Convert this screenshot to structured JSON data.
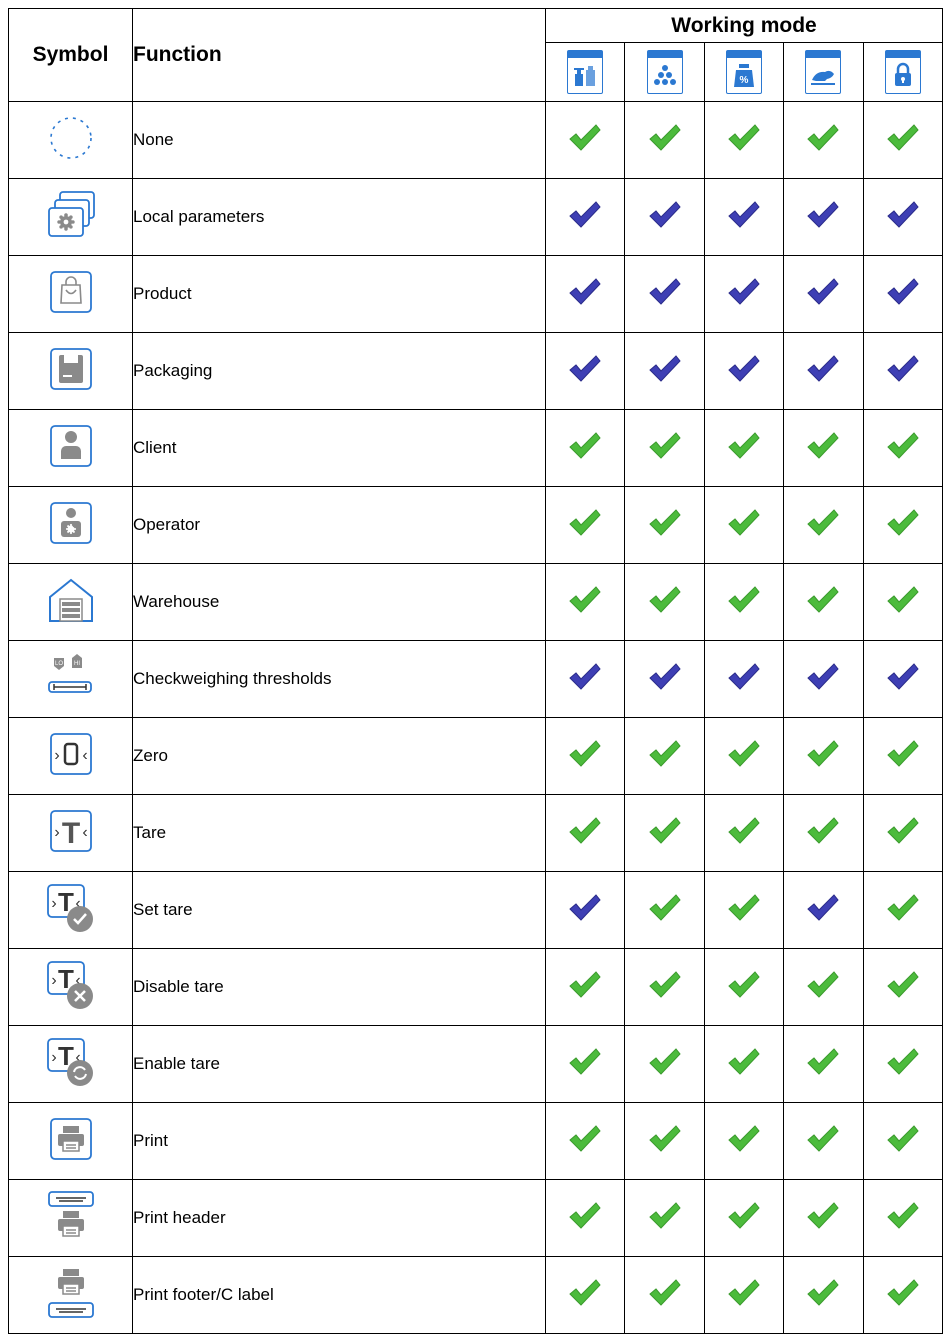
{
  "header": {
    "symbol": "Symbol",
    "function": "Function",
    "working_mode": "Working mode"
  },
  "modes": [
    {
      "icon": "weighing-mode-icon"
    },
    {
      "icon": "parts-counting-mode-icon"
    },
    {
      "icon": "percent-weighing-mode-icon"
    },
    {
      "icon": "animal-weighing-mode-icon"
    },
    {
      "icon": "peak-hold-mode-icon"
    }
  ],
  "colors": {
    "icon_blue": "#2b78d1",
    "check_green": "#4cbb3c",
    "check_blue": "#3e3fb4",
    "icon_grey": "#8a8a8a"
  },
  "rows": [
    {
      "function": "None",
      "icon": "none-icon",
      "marks": [
        "green",
        "green",
        "green",
        "green",
        "green"
      ]
    },
    {
      "function": "Local parameters",
      "icon": "local-parameters-icon",
      "marks": [
        "blue",
        "blue",
        "blue",
        "blue",
        "blue"
      ]
    },
    {
      "function": "Product",
      "icon": "product-icon",
      "marks": [
        "blue",
        "blue",
        "blue",
        "blue",
        "blue"
      ]
    },
    {
      "function": "Packaging",
      "icon": "packaging-icon",
      "marks": [
        "blue",
        "blue",
        "blue",
        "blue",
        "blue"
      ]
    },
    {
      "function": "Client",
      "icon": "client-icon",
      "marks": [
        "green",
        "green",
        "green",
        "green",
        "green"
      ]
    },
    {
      "function": "Operator",
      "icon": "operator-icon",
      "marks": [
        "green",
        "green",
        "green",
        "green",
        "green"
      ]
    },
    {
      "function": "Warehouse",
      "icon": "warehouse-icon",
      "marks": [
        "green",
        "green",
        "green",
        "green",
        "green"
      ]
    },
    {
      "function": "Checkweighing thresholds",
      "icon": "checkweighing-thresholds-icon",
      "marks": [
        "blue",
        "blue",
        "blue",
        "blue",
        "blue"
      ]
    },
    {
      "function": "Zero",
      "icon": "zero-icon",
      "marks": [
        "green",
        "green",
        "green",
        "green",
        "green"
      ]
    },
    {
      "function": "Tare",
      "icon": "tare-icon",
      "marks": [
        "green",
        "green",
        "green",
        "green",
        "green"
      ]
    },
    {
      "function": "Set tare",
      "icon": "set-tare-icon",
      "marks": [
        "blue",
        "green",
        "green",
        "blue",
        "green"
      ]
    },
    {
      "function": "Disable tare",
      "icon": "disable-tare-icon",
      "marks": [
        "green",
        "green",
        "green",
        "green",
        "green"
      ]
    },
    {
      "function": "Enable tare",
      "icon": "enable-tare-icon",
      "marks": [
        "green",
        "green",
        "green",
        "green",
        "green"
      ]
    },
    {
      "function": "Print",
      "icon": "print-icon",
      "marks": [
        "green",
        "green",
        "green",
        "green",
        "green"
      ]
    },
    {
      "function": "Print header",
      "icon": "print-header-icon",
      "marks": [
        "green",
        "green",
        "green",
        "green",
        "green"
      ]
    },
    {
      "function": "Print footer/C label",
      "icon": "print-footer-icon",
      "marks": [
        "green",
        "green",
        "green",
        "green",
        "green"
      ]
    }
  ]
}
